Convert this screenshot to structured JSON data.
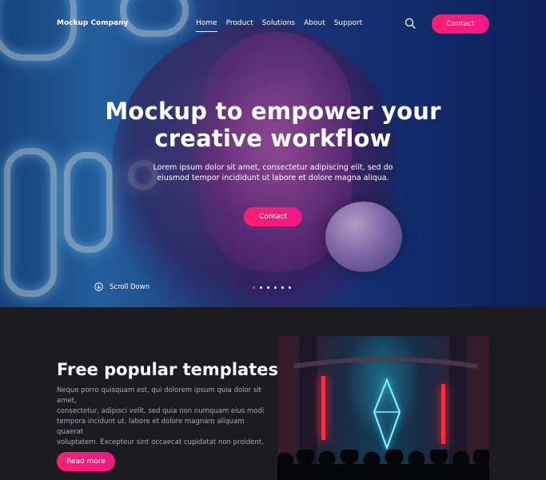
{
  "nav": {
    "brand": "Mockup Company",
    "links": [
      {
        "label": "Home",
        "active": true
      },
      {
        "label": "Product"
      },
      {
        "label": "Solutions"
      },
      {
        "label": "About"
      },
      {
        "label": "Support"
      }
    ],
    "search_icon": "search-icon",
    "contact_label": "Contact"
  },
  "hero": {
    "headline": "Mockup to empower your\ncreative workflow",
    "subheadline": "Lorem ipsum dolor sit amet, consectetur adipiscing elit, sed do\neiusmod tempor incididunt ut labore et dolore magna aliqua.",
    "cta_label": "Contact",
    "scroll_label": "Scroll Down",
    "scroll_icon": "arrow-down-circle-icon",
    "slides_total": 6,
    "slide_active": 1
  },
  "feature": {
    "title": "Free popular templates",
    "body": "Neque porro quisquam est, qui dolorem ipsum quia dolor sit amet,\nconsectetur, adipisci velit, sed quia non numquam eius modi\ntempora incidunt ut. labore et dolore magnam aliquam quaerat\nvoluptatem. Excepteur sint occaecat cupidatat non proident.",
    "button_label": "Read more"
  },
  "colors": {
    "accent": "#ff1f6f",
    "dark_bg": "#1c1c20",
    "body_text": "#a9a9b3"
  }
}
